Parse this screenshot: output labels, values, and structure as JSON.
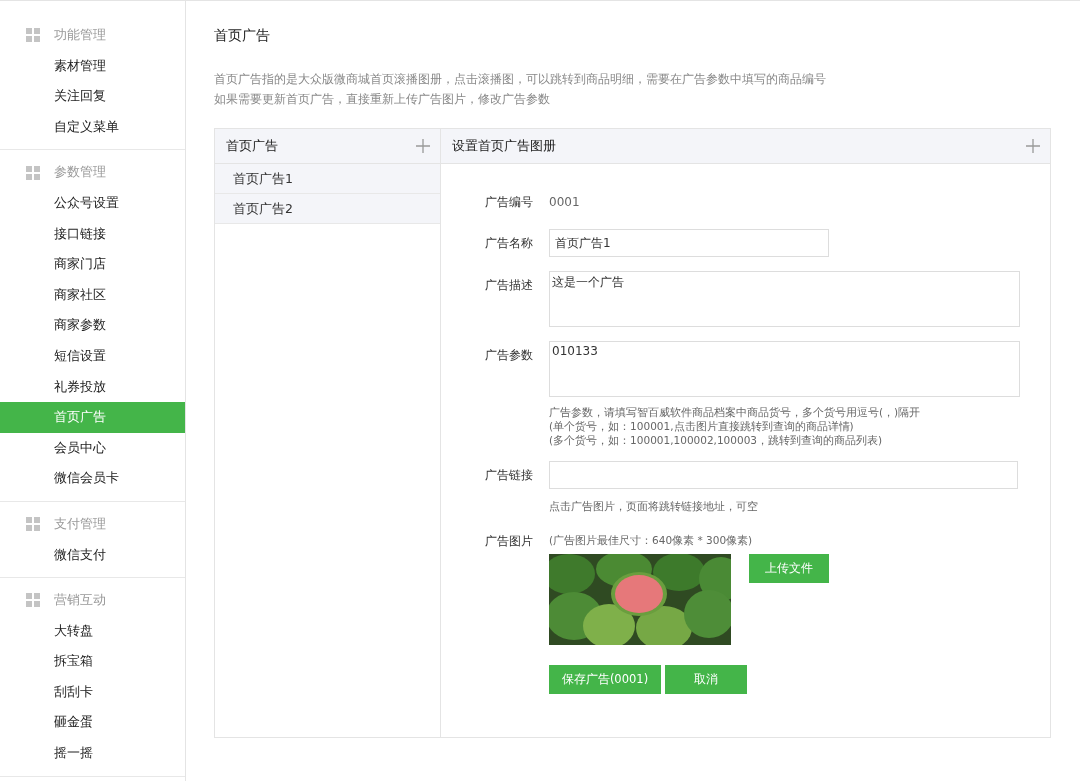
{
  "sidebar": {
    "groups": [
      {
        "title": "功能管理",
        "items": [
          {
            "label": "素材管理",
            "selected": false
          },
          {
            "label": "关注回复",
            "selected": false
          },
          {
            "label": "自定义菜单",
            "selected": false
          }
        ]
      },
      {
        "title": "参数管理",
        "items": [
          {
            "label": "公众号设置",
            "selected": false
          },
          {
            "label": "接口链接",
            "selected": false
          },
          {
            "label": "商家门店",
            "selected": false
          },
          {
            "label": "商家社区",
            "selected": false
          },
          {
            "label": "商家参数",
            "selected": false
          },
          {
            "label": "短信设置",
            "selected": false
          },
          {
            "label": "礼券投放",
            "selected": false
          },
          {
            "label": "首页广告",
            "selected": true
          },
          {
            "label": "会员中心",
            "selected": false
          },
          {
            "label": "微信会员卡",
            "selected": false
          }
        ]
      },
      {
        "title": "支付管理",
        "items": [
          {
            "label": "微信支付",
            "selected": false
          }
        ]
      },
      {
        "title": "营销互动",
        "items": [
          {
            "label": "大转盘",
            "selected": false
          },
          {
            "label": "拆宝箱",
            "selected": false
          },
          {
            "label": "刮刮卡",
            "selected": false
          },
          {
            "label": "砸金蛋",
            "selected": false
          },
          {
            "label": "摇一摇",
            "selected": false
          }
        ]
      }
    ]
  },
  "page": {
    "title": "首页广告",
    "description": [
      "首页广告指的是大众版微商城首页滚播图册，点击滚播图，可以跳转到商品明细，需要在广告参数中填写的商品编号",
      "如果需要更新首页广告，直接重新上传广告图片，修改广告参数"
    ]
  },
  "ad_list": {
    "title": "首页广告",
    "items": [
      {
        "label": "首页广告1"
      },
      {
        "label": "首页广告2"
      }
    ]
  },
  "form": {
    "title": "设置首页广告图册",
    "fields": [
      {
        "kind": "static",
        "label": "广告编号",
        "value": "0001"
      },
      {
        "kind": "input",
        "label": "广告名称",
        "value": "首页广告1"
      },
      {
        "kind": "textarea",
        "label": "广告描述",
        "value": "这是一个广告"
      },
      {
        "kind": "textarea",
        "label": "广告参数",
        "value": "010133",
        "hints": [
          "广告参数，请填写智百威软件商品档案中商品货号，多个货号用逗号(，)隔开",
          "(单个货号，如：100001,点击图片直接跳转到查询的商品详情)",
          "(多个货号，如：100001,100002,100003，跳转到查询的商品列表)"
        ]
      },
      {
        "kind": "input_wide",
        "label": "广告链接",
        "hints": [
          "点击广告图片，页面将跳转链接地址，可空"
        ]
      },
      {
        "kind": "image",
        "label": "广告图片",
        "note": "(广告图片最佳尺寸：640像素 * 300像素)",
        "button": "上传文件"
      }
    ],
    "buttons": [
      "保存广告(0001)",
      "取消"
    ]
  }
}
